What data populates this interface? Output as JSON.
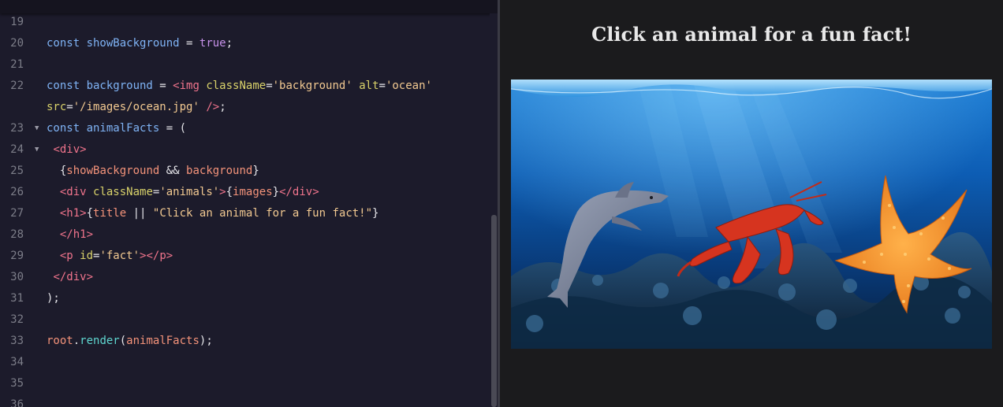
{
  "editor": {
    "lines": [
      {
        "num": "19"
      },
      {
        "num": "20",
        "tokens": [
          [
            "k",
            "const "
          ],
          [
            "id",
            "showBackground"
          ],
          [
            "op",
            " = "
          ],
          [
            "bl",
            "true"
          ],
          [
            "op",
            ";"
          ]
        ]
      },
      {
        "num": "21"
      },
      {
        "num": "22",
        "tokens": [
          [
            "k",
            "const "
          ],
          [
            "id",
            "background"
          ],
          [
            "op",
            " = "
          ],
          [
            "tg",
            "<img "
          ],
          [
            "at",
            "className"
          ],
          [
            "op",
            "="
          ],
          [
            "st",
            "'background'"
          ],
          [
            "op",
            " "
          ],
          [
            "at",
            "alt"
          ],
          [
            "op",
            "="
          ],
          [
            "st",
            "'ocean'"
          ]
        ]
      },
      {
        "num": "",
        "tokens": [
          [
            "at",
            "src"
          ],
          [
            "op",
            "="
          ],
          [
            "st",
            "'/images/ocean.jpg'"
          ],
          [
            "op",
            " "
          ],
          [
            "tg",
            "/>"
          ],
          [
            "op",
            ";"
          ]
        ]
      },
      {
        "num": "23",
        "fold": "▼",
        "tokens": [
          [
            "k",
            "const "
          ],
          [
            "id",
            "animalFacts"
          ],
          [
            "op",
            " = ("
          ]
        ]
      },
      {
        "num": "24",
        "fold": "▼",
        "tokens": [
          [
            "op",
            " "
          ],
          [
            "tg",
            "<div>"
          ]
        ]
      },
      {
        "num": "25",
        "tokens": [
          [
            "op",
            "  {"
          ],
          [
            "ar",
            "showBackground"
          ],
          [
            "op",
            " && "
          ],
          [
            "ar",
            "background"
          ],
          [
            "op",
            "}"
          ]
        ]
      },
      {
        "num": "26",
        "tokens": [
          [
            "op",
            "  "
          ],
          [
            "tg",
            "<div "
          ],
          [
            "at",
            "className"
          ],
          [
            "op",
            "="
          ],
          [
            "st",
            "'animals'"
          ],
          [
            "tg",
            ">"
          ],
          [
            "op",
            "{"
          ],
          [
            "ar",
            "images"
          ],
          [
            "op",
            "}"
          ],
          [
            "tg",
            "</div>"
          ]
        ]
      },
      {
        "num": "27",
        "tokens": [
          [
            "op",
            "  "
          ],
          [
            "tg",
            "<h1>"
          ],
          [
            "op",
            "{"
          ],
          [
            "ar",
            "title"
          ],
          [
            "op",
            " || "
          ],
          [
            "st",
            "\"Click an animal for a fun fact!\""
          ],
          [
            "op",
            "}"
          ]
        ]
      },
      {
        "num": "28",
        "tokens": [
          [
            "op",
            "  "
          ],
          [
            "tg",
            "</h1>"
          ]
        ]
      },
      {
        "num": "29",
        "tokens": [
          [
            "op",
            "  "
          ],
          [
            "tg",
            "<p "
          ],
          [
            "at",
            "id"
          ],
          [
            "op",
            "="
          ],
          [
            "st",
            "'fact'"
          ],
          [
            "tg",
            "></p>"
          ]
        ]
      },
      {
        "num": "30",
        "tokens": [
          [
            "op",
            " "
          ],
          [
            "tg",
            "</div>"
          ]
        ]
      },
      {
        "num": "31",
        "tokens": [
          [
            "op",
            ");"
          ]
        ]
      },
      {
        "num": "32"
      },
      {
        "num": "33",
        "tokens": [
          [
            "ar",
            "root"
          ],
          [
            "op",
            "."
          ],
          [
            "fn",
            "render"
          ],
          [
            "op",
            "("
          ],
          [
            "ar",
            "animalFacts"
          ],
          [
            "op",
            ");"
          ]
        ]
      },
      {
        "num": "34"
      },
      {
        "num": "35"
      },
      {
        "num": "36"
      }
    ]
  },
  "preview": {
    "title": "Click an animal for a fun fact!"
  }
}
